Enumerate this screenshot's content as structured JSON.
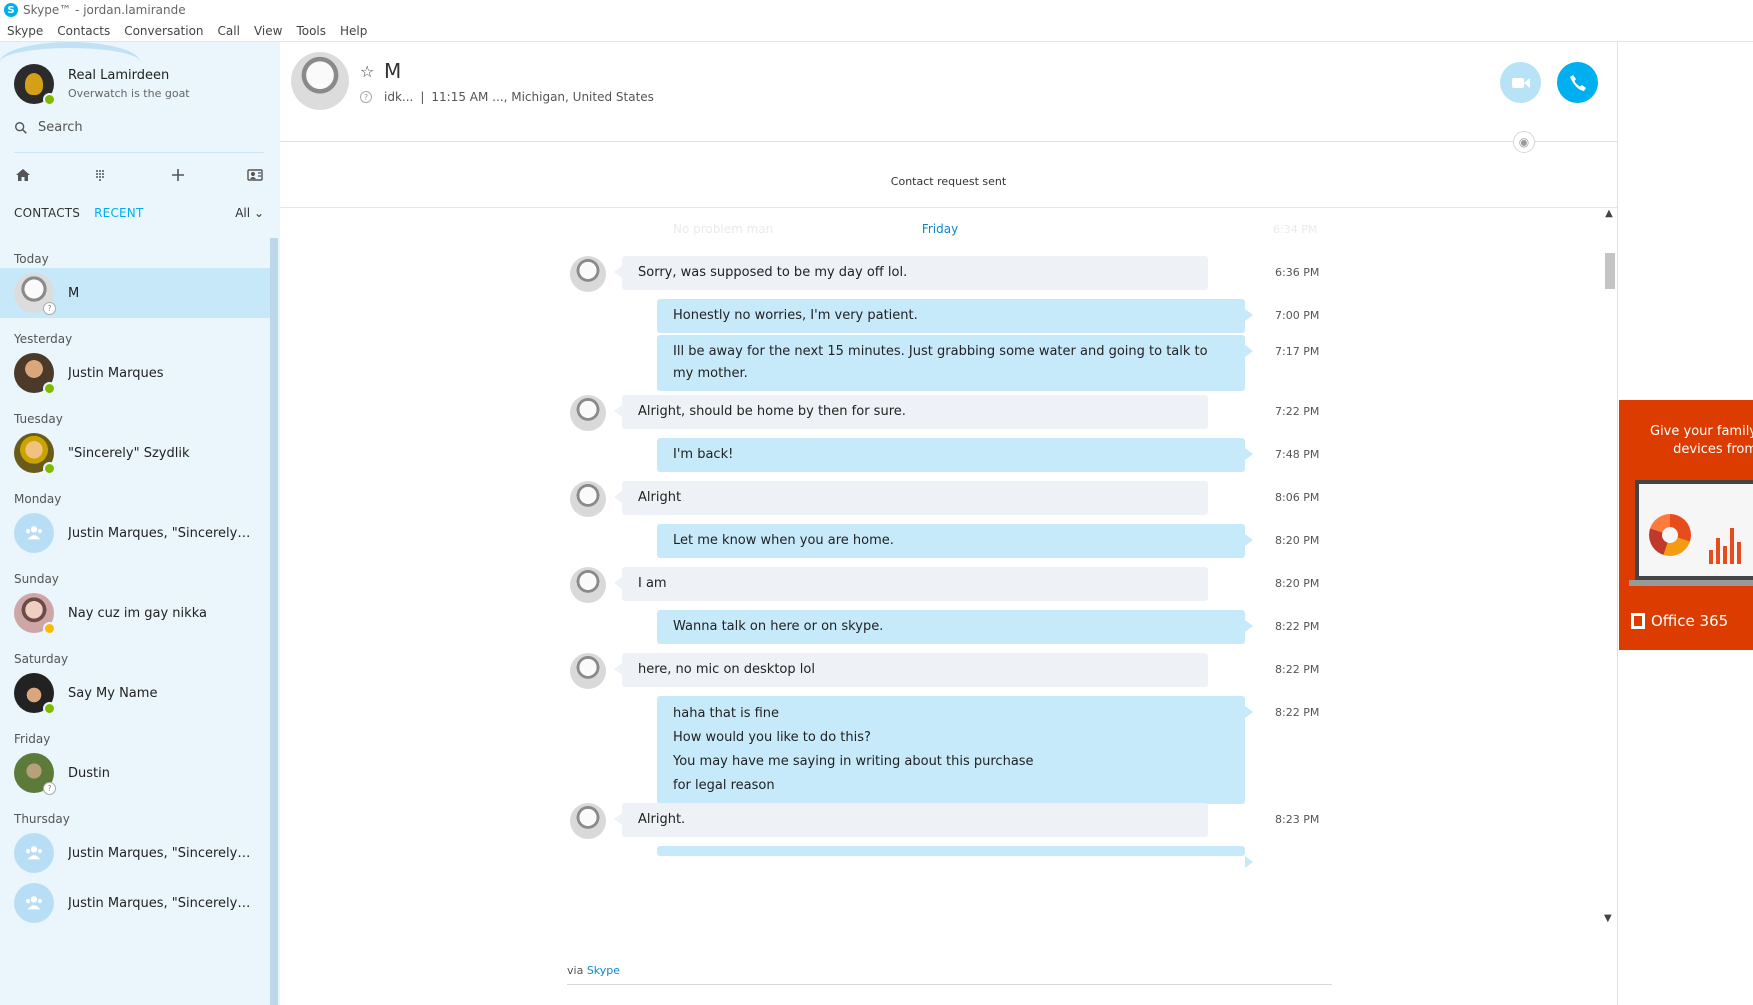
{
  "window": {
    "title": "Skype™ - jordan.lamirande"
  },
  "menu": [
    "Skype",
    "Contacts",
    "Conversation",
    "Call",
    "View",
    "Tools",
    "Help"
  ],
  "profile": {
    "name": "Real Lamirdeen",
    "mood": "Overwatch is the goat"
  },
  "search": {
    "placeholder": "Search"
  },
  "tabs": {
    "contacts": "CONTACTS",
    "recent": "RECENT",
    "filter": "All"
  },
  "recent_groups": [
    {
      "label": "Today",
      "contact": "M"
    },
    {
      "label": "Yesterday",
      "contact": "Justin Marques"
    },
    {
      "label": "Tuesday",
      "contact": "\"Sincerely\" Szydlik"
    },
    {
      "label": "Monday",
      "contact": "Justin Marques, \"Sincerely\" Sz..."
    },
    {
      "label": "Sunday",
      "contact": "Nay cuz im gay nikka"
    },
    {
      "label": "Saturday",
      "contact": "Say My Name"
    },
    {
      "label": "Friday",
      "contact": "Dustin"
    },
    {
      "label": "Thursday",
      "contact": "Justin Marques, \"Sincerely\" Sz..."
    },
    {
      "label": "",
      "contact": "Justin Marques, \"Sincerely\" Sz..."
    }
  ],
  "chat": {
    "name": "M",
    "status": "idk...",
    "location": "11:15 AM ..., Michigan, United States",
    "request_notice": "Contact request sent",
    "faded_message": "No problem man",
    "faded_time": "6:34 PM",
    "day_separator": "Friday",
    "via_label": "via",
    "via_link": "Skype"
  },
  "messages": [
    {
      "dir": "in",
      "text": "Sorry, was supposed to be my day off lol.",
      "time": "6:36 PM"
    },
    {
      "dir": "out",
      "text": "Honestly no worries, I'm very patient.",
      "time": "7:00 PM"
    },
    {
      "dir": "out",
      "text": "Ill be away for the next 15 minutes. Just grabbing some water and going to talk to my mother.",
      "time": "7:17 PM"
    },
    {
      "dir": "in",
      "text": "Alright, should be home by then for sure.",
      "time": "7:22 PM"
    },
    {
      "dir": "out",
      "text": "I'm back!",
      "time": "7:48 PM"
    },
    {
      "dir": "in",
      "text": "Alright",
      "time": "8:06 PM"
    },
    {
      "dir": "out",
      "text": "Let me know when you are home.",
      "time": "8:20 PM"
    },
    {
      "dir": "in",
      "text": "I am",
      "time": "8:20 PM"
    },
    {
      "dir": "out",
      "text": "Wanna talk on here or on skype.",
      "time": "8:22 PM"
    },
    {
      "dir": "in",
      "text": "here, no mic on desktop lol",
      "time": "8:22 PM"
    },
    {
      "dir": "out",
      "lines": [
        "haha that is fine",
        "How would you like to do this?",
        "You may have me saying in writing about this purchase",
        "for legal reason"
      ],
      "time": "8:22 PM"
    },
    {
      "dir": "in",
      "text": "Alright.",
      "time": "8:23 PM"
    }
  ],
  "ad": {
    "line1": "Give your family",
    "line2": "devices from",
    "brand": "Office 365"
  }
}
